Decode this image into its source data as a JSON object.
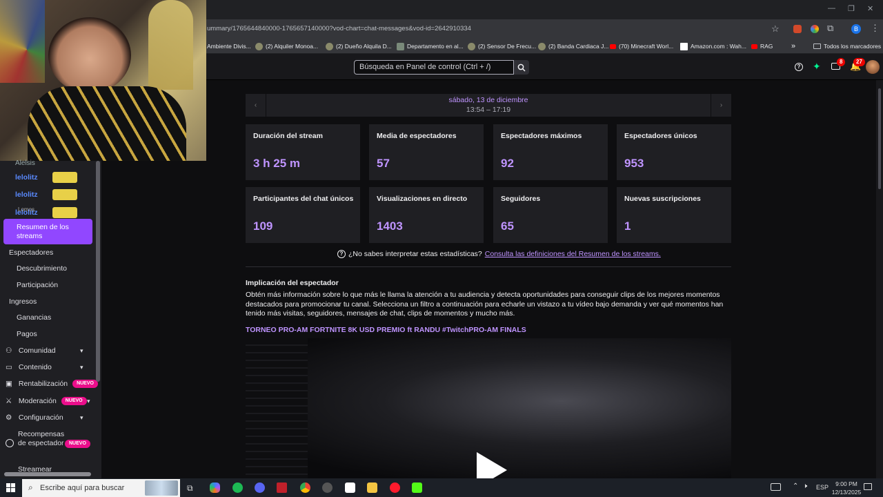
{
  "browser": {
    "url": "ummary/1765644840000-1765657140000?vod-chart=chat-messages&vod-id=2642910334",
    "bookmarks": [
      "Ambiente Divis...",
      "(2) Alquiler Monoa...",
      "(2) Dueño Alquila D...",
      "Departamento en al...",
      "(2) Sensor De Frecu...",
      "(2) Banda Cardiaca J...",
      "(70) Minecraft Worl...",
      "Amazon.com : Wah...",
      "RAG"
    ],
    "bookmarks_more": "»",
    "all_bookmarks": "Todos los marcadores",
    "profile_initial": "B"
  },
  "header": {
    "search_placeholder": "Búsqueda en Panel de control (Ctrl + /)",
    "notifications_inbox": "8",
    "notifications_bell": "27"
  },
  "chat_overlay": {
    "names": [
      "lelolitz",
      "lelolitz",
      "lelolitz"
    ],
    "username_fragment": "Lomos",
    "partial": "Alelsis"
  },
  "sidebar": {
    "active": "Resumen de los streams",
    "items": [
      {
        "label": "Espectadores"
      },
      {
        "label": "Descubrimiento"
      },
      {
        "label": "Participación"
      },
      {
        "label": "Ingresos"
      },
      {
        "label": "Ganancias"
      },
      {
        "label": "Pagos"
      },
      {
        "label": "Comunidad"
      },
      {
        "label": "Contenido"
      },
      {
        "label": "Rentabilización",
        "badge": "NUEVO"
      },
      {
        "label": "Moderación",
        "badge": "NUEVO"
      },
      {
        "label": "Configuración"
      },
      {
        "label": "Recompensas de espectador",
        "badge": "NUEVO"
      },
      {
        "label": "Streamear"
      }
    ]
  },
  "summary": {
    "date": "sábado, 13 de diciembre",
    "time_range": "13:54 – 17:19",
    "stats": [
      {
        "label": "Duración del stream",
        "value": "3 h 25 m"
      },
      {
        "label": "Media de espectadores",
        "value": "57"
      },
      {
        "label": "Espectadores máximos",
        "value": "92"
      },
      {
        "label": "Espectadores únicos",
        "value": "953"
      },
      {
        "label": "Participantes del chat únicos",
        "value": "109"
      },
      {
        "label": "Visualizaciones en directo",
        "value": "1403"
      },
      {
        "label": "Seguidores",
        "value": "65"
      },
      {
        "label": "Nuevas suscripciones",
        "value": "1"
      }
    ],
    "help_text": "¿No sabes interpretar estas estadísticas?",
    "help_link": "Consulta las definiciones del Resumen de los streams.",
    "engagement_title": "Implicación del espectador",
    "engagement_body": "Obtén más información sobre lo que más le llama la atención a tu audiencia y detecta oportunidades para conseguir clips de los mejores momentos destacados para promocionar tu canal. Selecciona un filtro a continuación para echarle un vistazo a tu vídeo bajo demanda y ver qué momentos han tenido más visitas, seguidores, mensajes de chat, clips de momentos y mucho más.",
    "vod_title": "TORNEO PRO-AM FORTNITE 8K USD PREMIO ft RANDU #TwitchPRO-AM FINALS"
  },
  "taskbar": {
    "search_placeholder": "Escribe aquí para buscar",
    "lang": "ESP",
    "time": "9:00 PM",
    "date": "12/13/2025"
  },
  "colors": {
    "accent": "#bf94ff",
    "active_nav": "#9147ff",
    "badge": "#eb0e8b",
    "bg": "#0e0e10",
    "card": "#1f1f23"
  }
}
